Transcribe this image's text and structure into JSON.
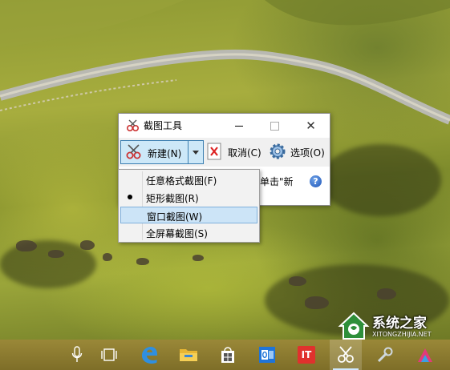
{
  "window": {
    "title": "截图工具",
    "minimize_icon": "minimize-icon",
    "maximize_icon": "maximize-icon",
    "close_glyph": "✕"
  },
  "toolbar": {
    "new_label": "新建(N)",
    "cancel_label": "取消(C)",
    "options_label": "选项(O)"
  },
  "content": {
    "hint_text": "单击\"新",
    "help_glyph": "?"
  },
  "menu": {
    "items": [
      {
        "label": "任意格式截图(F)",
        "selected": false,
        "highlighted": false
      },
      {
        "label": "矩形截图(R)",
        "selected": true,
        "highlighted": false
      },
      {
        "label": "窗口截图(W)",
        "selected": false,
        "highlighted": true
      },
      {
        "label": "全屏幕截图(S)",
        "selected": false,
        "highlighted": false
      }
    ]
  },
  "taskbar": {
    "items": [
      "microphone-icon",
      "task-view-icon",
      "edge-icon",
      "file-explorer-icon",
      "store-icon",
      "outlook-icon",
      "it-app-icon",
      "snipping-tool-icon",
      "tools-icon",
      "photos-icon"
    ],
    "it_label": "IT"
  },
  "watermark": {
    "title": "系统之家",
    "url": "XITONGZHIJIA.NET"
  },
  "colors": {
    "accent": "#3c7fb1",
    "highlight": "#cce4f7",
    "taskbar": "#8b7a30"
  }
}
